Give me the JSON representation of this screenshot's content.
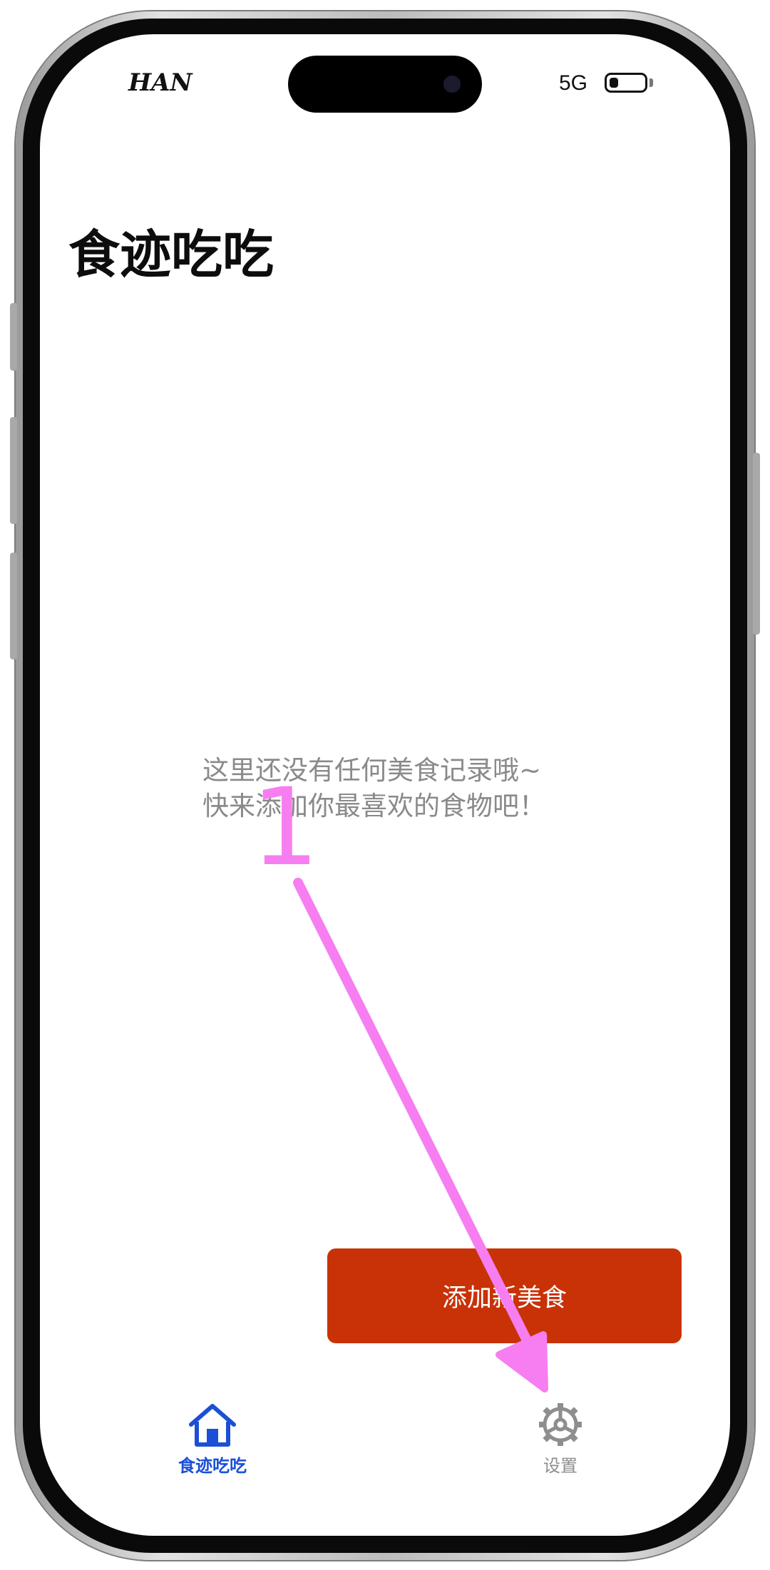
{
  "status_bar": {
    "carrier": "HAN",
    "network": "5G",
    "battery_level": 0.25
  },
  "page": {
    "title": "食迹吃吃"
  },
  "empty_state": {
    "line1": "这里还没有任何美食记录哦~",
    "line2": "快来添加你最喜欢的食物吧！"
  },
  "actions": {
    "add_food_label": "添加新美食"
  },
  "tab_bar": {
    "items": [
      {
        "label": "食迹吃吃",
        "icon": "house-icon",
        "selected": true
      },
      {
        "label": "设置",
        "icon": "gear-icon",
        "selected": false
      }
    ]
  },
  "annotation": {
    "step_number": "1",
    "color": "#f77ef0"
  },
  "colors": {
    "accent": "#c93207",
    "tab_selected": "#1b4fd6",
    "tab_unselected": "#8e8e8e",
    "secondary_text": "#8a8a8a"
  }
}
